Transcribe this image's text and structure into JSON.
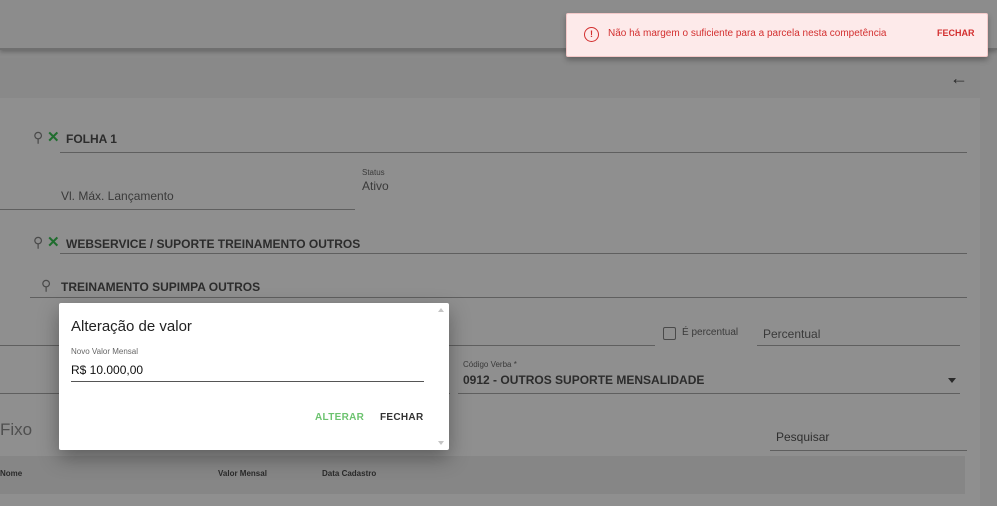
{
  "form": {
    "folha": "FOLHA 1",
    "vl_max_label": "Vl. Máx. Lançamento",
    "status_label": "Status",
    "status_value": "Ativo",
    "servico": "WEBSERVICE / SUPORTE TREINAMENTO OUTROS",
    "produto": "TREINAMENTO SUPIMPA OUTROS",
    "percentual_checkbox_label": "É percentual",
    "percentual_placeholder": "Percentual",
    "codigo_verba_label": "Código Verba *",
    "codigo_verba_value": "0912 - OUTROS SUPORTE MENSALIDADE"
  },
  "section": {
    "title": "Fixo",
    "search_placeholder": "Pesquisar"
  },
  "table": {
    "columns": [
      "Nome",
      "Valor Mensal",
      "Data Cadastro"
    ]
  },
  "modal": {
    "title": "Alteração de valor",
    "field_label": "Novo Valor Mensal",
    "field_value": "R$ 10.000,00",
    "alterar_label": "ALTERAR",
    "fechar_label": "FECHAR"
  },
  "toast": {
    "message": "Não há margem o suficiente para a parcela nesta competência",
    "action_label": "FECHAR",
    "color": "#d32f2f"
  },
  "icons": {
    "back": "arrow-left-icon",
    "search": "search-icon",
    "clear": "close-icon",
    "alert": "alert-circle-icon"
  }
}
